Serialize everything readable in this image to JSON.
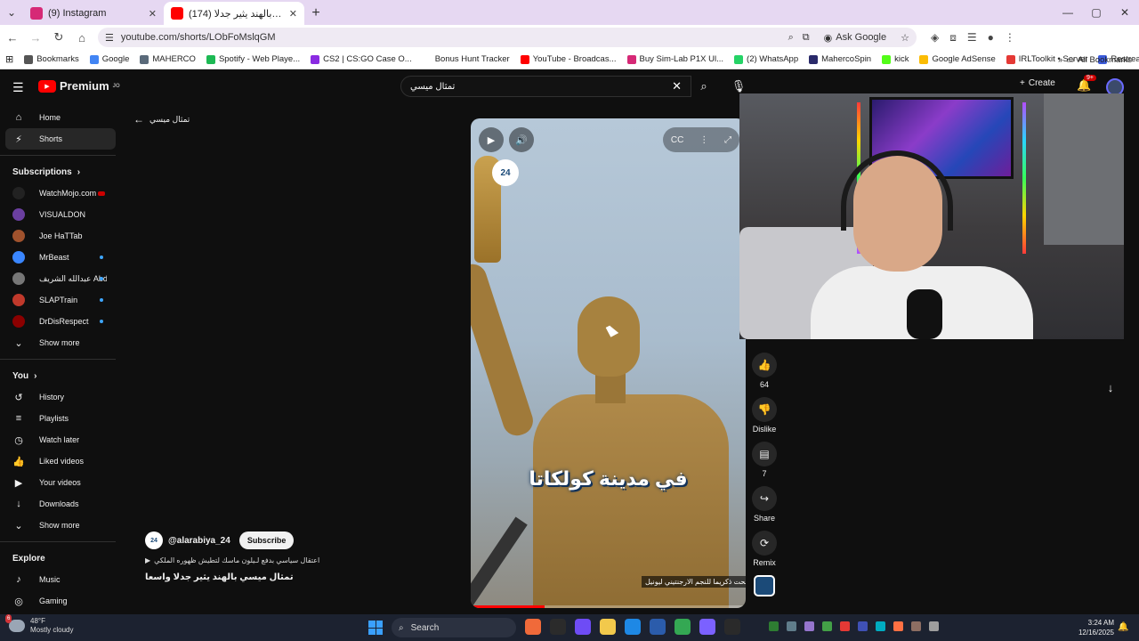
{
  "browser": {
    "tabs": [
      {
        "title": "(9) Instagram",
        "color": "#d62976",
        "active": false
      },
      {
        "title": "(174) تمثال ميسي بالهند يثير جدلا",
        "color": "#ff0000",
        "active": true
      }
    ],
    "url": "youtube.com/shorts/LObFoMslqGM",
    "ask_google": "Ask Google",
    "bookmarks": [
      {
        "label": "Bookmarks",
        "color": "#555555"
      },
      {
        "label": "Google",
        "color": "#4285f4"
      },
      {
        "label": "MAHERCO",
        "color": "#5a6a7a"
      },
      {
        "label": "Spotify - Web Playe...",
        "color": "#1db954"
      },
      {
        "label": "CS2 | CS:GO Case O...",
        "color": "#8a2be2"
      },
      {
        "label": "Bonus Hunt Tracker",
        "color": "#ffffff"
      },
      {
        "label": "YouTube - Broadcas...",
        "color": "#ff0000"
      },
      {
        "label": "Buy Sim-Lab P1X Ul...",
        "color": "#d62976"
      },
      {
        "label": "(2) WhatsApp",
        "color": "#25d366"
      },
      {
        "label": "MahercoSpin",
        "color": "#2a2a6a"
      },
      {
        "label": "kick",
        "color": "#53fc18"
      },
      {
        "label": "Google AdSense",
        "color": "#fbbc04"
      },
      {
        "label": "IRLToolkit • Server",
        "color": "#e53935"
      },
      {
        "label": "Restream",
        "color": "#3b5bdb"
      }
    ],
    "all_bookmarks": "All Bookmarks"
  },
  "youtube": {
    "logo": "Premium",
    "logo_sup": "JO",
    "search_value": "تمثال ميسي",
    "create": "Create",
    "notif_count": "9+",
    "back_label": "تمثال ميسي",
    "sidebar": {
      "main": [
        {
          "label": "Home",
          "icon": "home-icon",
          "glyph": "⌂"
        },
        {
          "label": "Shorts",
          "icon": "shorts-icon",
          "glyph": "⚡",
          "active": true
        }
      ],
      "subscriptions_title": "Subscriptions",
      "subscriptions": [
        {
          "label": "WatchMojo.com",
          "color": "#222222",
          "live": true
        },
        {
          "label": "VISUALDON",
          "color": "#6b3fa0"
        },
        {
          "label": "Joe HaTTab",
          "color": "#a0522d"
        },
        {
          "label": "MrBeast",
          "color": "#3a86ff",
          "dot": true
        },
        {
          "label": "عبدالله الشريف Abdul...",
          "color": "#777777",
          "dot": true
        },
        {
          "label": "SLAPTrain",
          "color": "#c0392b",
          "dot": true
        },
        {
          "label": "DrDisRespect",
          "color": "#8b0000",
          "dot": true
        }
      ],
      "show_more_1": "Show more",
      "you_title": "You",
      "you": [
        {
          "label": "History",
          "icon": "history-icon",
          "glyph": "↺"
        },
        {
          "label": "Playlists",
          "icon": "playlists-icon",
          "glyph": "≡"
        },
        {
          "label": "Watch later",
          "icon": "watch-later-icon",
          "glyph": "◷"
        },
        {
          "label": "Liked videos",
          "icon": "liked-icon",
          "glyph": "👍"
        },
        {
          "label": "Your videos",
          "icon": "your-videos-icon",
          "glyph": "▶"
        },
        {
          "label": "Downloads",
          "icon": "downloads-icon",
          "glyph": "↓"
        }
      ],
      "show_more_2": "Show more",
      "explore_title": "Explore",
      "explore": [
        {
          "label": "Music",
          "icon": "music-icon",
          "glyph": "♪"
        },
        {
          "label": "Gaming",
          "icon": "gaming-icon",
          "glyph": "◎"
        }
      ]
    },
    "short": {
      "overlay_text": "في مدينة كولكاتا",
      "caption": "تحت ذكريما للنجم الارجنتيني ليونيل",
      "channel_logo": "24",
      "progress": 0.27
    },
    "info": {
      "channel": "@alarabiya_24",
      "subscribe": "Subscribe",
      "description": "اعتقال سياسي بدفع لـيلون ماسك لتطيش ظهوره الملكي",
      "title": "تمثال ميسي بالهند يثير جدلا واسعا"
    },
    "actions": {
      "likes": "64",
      "dislike": "Dislike",
      "comments": "7",
      "share": "Share",
      "remix": "Remix"
    }
  },
  "taskbar": {
    "temp": "48°F",
    "weather": "Mostly cloudy",
    "weather_badge": "6",
    "search": "Search",
    "time": "3:24 AM",
    "date": "12/16/2025",
    "apps": [
      "#f06a3a",
      "#2b2b2b",
      "#6e4cf5",
      "#f2c94c",
      "#1e88e5",
      "#2b5cab",
      "#34a853",
      "#7b61ff",
      "#2a2a2a"
    ],
    "tray": [
      "#2e7d32",
      "#607d8b",
      "#9575cd",
      "#43a047",
      "#e53935",
      "#3f51b5",
      "#00acc1",
      "#ff7043",
      "#8d6e63",
      "#9e9e9e"
    ]
  }
}
